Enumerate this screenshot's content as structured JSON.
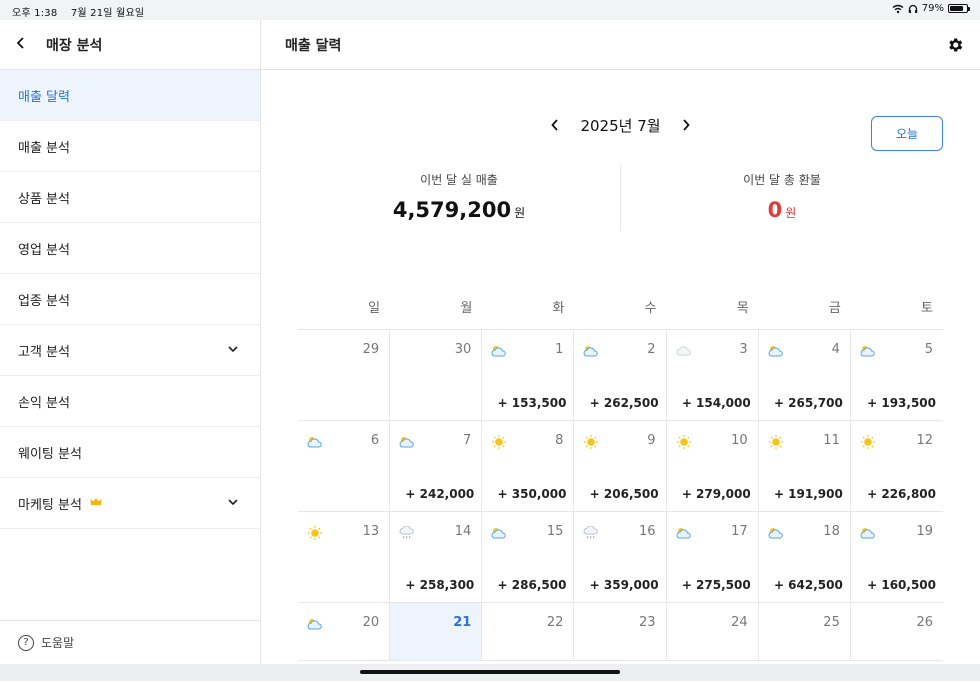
{
  "status_bar": {
    "time": "오후 1:38",
    "date": "7월 21일 월요일",
    "battery": "79%",
    "battery_level": 0.79
  },
  "sidebar": {
    "title": "매장 분석",
    "items": [
      {
        "label": "매출 달력",
        "active": true
      },
      {
        "label": "매출 분석"
      },
      {
        "label": "상품 분석"
      },
      {
        "label": "영업 분석"
      },
      {
        "label": "업종 분석"
      },
      {
        "label": "고객 분석",
        "has_chevron": true
      },
      {
        "label": "손익 분석"
      },
      {
        "label": "웨이팅 분석"
      },
      {
        "label": "마케팅 분석",
        "has_chevron": true,
        "badge_icon": "crown-icon"
      }
    ],
    "help_label": "도움말"
  },
  "main": {
    "title": "매출 달력",
    "month_label": "2025년 7월",
    "today_button": "오늘",
    "stats": {
      "sales_label": "이번 달 실 매출",
      "sales_value": "4,579,200",
      "sales_unit": "원",
      "refund_label": "이번 달 총 환불",
      "refund_value": "0",
      "refund_unit": "원"
    }
  },
  "calendar": {
    "weekdays": [
      "일",
      "월",
      "화",
      "수",
      "목",
      "금",
      "토"
    ],
    "weeks": [
      [
        {
          "day": "29",
          "weather": "",
          "amount": ""
        },
        {
          "day": "30",
          "weather": "",
          "amount": ""
        },
        {
          "day": "1",
          "weather": "cloudy-sun-icon",
          "amount": "+ 153,500"
        },
        {
          "day": "2",
          "weather": "cloudy-sun-icon",
          "amount": "+ 262,500"
        },
        {
          "day": "3",
          "weather": "cloud-icon",
          "amount": "+ 154,000"
        },
        {
          "day": "4",
          "weather": "cloudy-sun-icon",
          "amount": "+ 265,700"
        },
        {
          "day": "5",
          "weather": "cloudy-sun-icon",
          "amount": "+ 193,500"
        }
      ],
      [
        {
          "day": "6",
          "weather": "cloudy-sun-icon",
          "amount": ""
        },
        {
          "day": "7",
          "weather": "cloudy-sun-icon",
          "amount": "+ 242,000"
        },
        {
          "day": "8",
          "weather": "sun-icon",
          "amount": "+ 350,000"
        },
        {
          "day": "9",
          "weather": "sun-icon",
          "amount": "+ 206,500"
        },
        {
          "day": "10",
          "weather": "sun-icon",
          "amount": "+ 279,000"
        },
        {
          "day": "11",
          "weather": "sun-icon",
          "amount": "+ 191,900"
        },
        {
          "day": "12",
          "weather": "sun-icon",
          "amount": "+ 226,800"
        }
      ],
      [
        {
          "day": "13",
          "weather": "sun-icon",
          "amount": ""
        },
        {
          "day": "14",
          "weather": "rain-icon",
          "amount": "+ 258,300"
        },
        {
          "day": "15",
          "weather": "cloudy-sun-icon",
          "amount": "+ 286,500"
        },
        {
          "day": "16",
          "weather": "rain-icon",
          "amount": "+ 359,000"
        },
        {
          "day": "17",
          "weather": "cloudy-sun-icon",
          "amount": "+ 275,500"
        },
        {
          "day": "18",
          "weather": "cloudy-sun-icon",
          "amount": "+ 642,500"
        },
        {
          "day": "19",
          "weather": "cloudy-sun-icon",
          "amount": "+ 160,500"
        }
      ],
      [
        {
          "day": "20",
          "weather": "cloudy-sun-icon",
          "amount": ""
        },
        {
          "day": "21",
          "weather": "",
          "amount": "",
          "today": true
        },
        {
          "day": "22",
          "weather": "",
          "amount": ""
        },
        {
          "day": "23",
          "weather": "",
          "amount": ""
        },
        {
          "day": "24",
          "weather": "",
          "amount": ""
        },
        {
          "day": "25",
          "weather": "",
          "amount": ""
        },
        {
          "day": "26",
          "weather": "",
          "amount": ""
        }
      ]
    ]
  },
  "colors": {
    "accent": "#2a72d9",
    "refund": "#e23a3a",
    "active_bg": "#eef5fe"
  }
}
